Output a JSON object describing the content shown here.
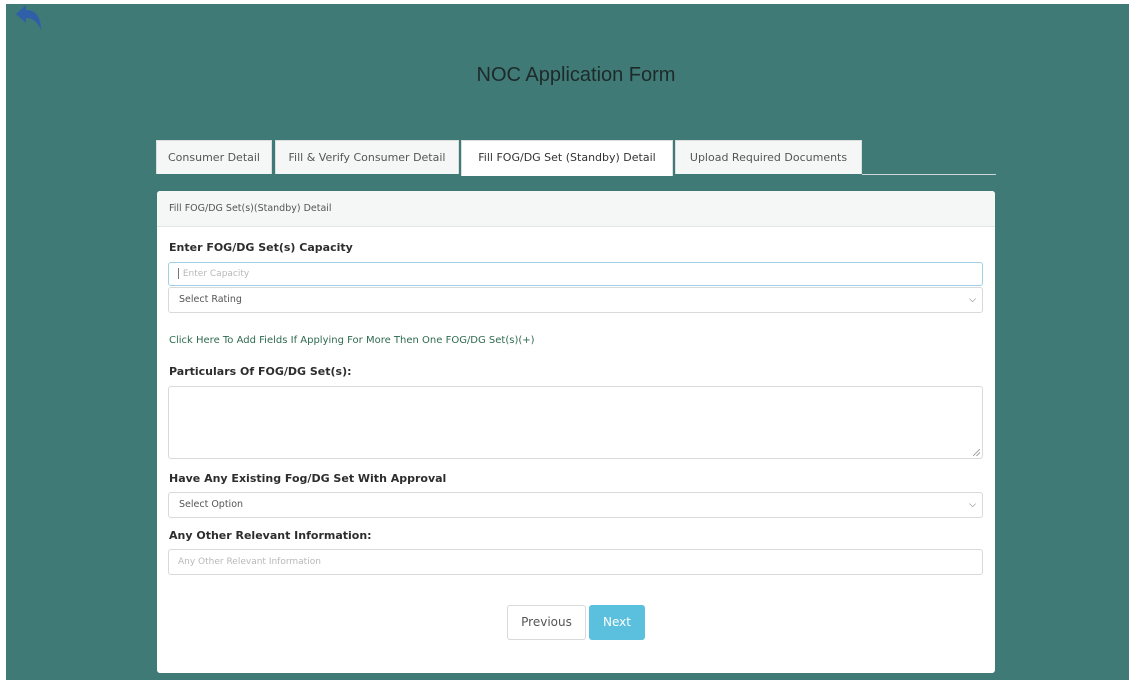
{
  "page": {
    "title": "NOC Application Form"
  },
  "tabs": [
    {
      "label": "Consumer Detail"
    },
    {
      "label": "Fill & Verify Consumer Detail"
    },
    {
      "label": "Fill FOG/DG Set (Standby) Detail"
    },
    {
      "label": "Upload Required Documents"
    }
  ],
  "active_tab": 2,
  "panel": {
    "header": "Fill FOG/DG Set(s)(Standby) Detail",
    "capacity_label": "Enter FOG/DG Set(s) Capacity",
    "capacity_placeholder": "Enter Capacity",
    "rating_select": "Select Rating",
    "add_fields_link": "Click Here To Add Fields If Applying For More Then One FOG/DG Set(s)(+)",
    "particulars_label": "Particulars Of FOG/DG Set(s):",
    "existing_label": "Have Any Existing Fog/DG Set With Approval",
    "existing_select": "Select Option",
    "other_label": "Any Other Relevant Information:",
    "other_placeholder": "Any Other Relevant Information"
  },
  "buttons": {
    "previous": "Previous",
    "next": "Next"
  },
  "icons": {
    "back": "back-arrow-icon",
    "dropdown": "chevron-down-icon"
  },
  "colors": {
    "background": "#3f7a76",
    "next_button": "#5bc0de",
    "link": "#2e6b4f",
    "back_arrow": "#2f5fa8"
  }
}
